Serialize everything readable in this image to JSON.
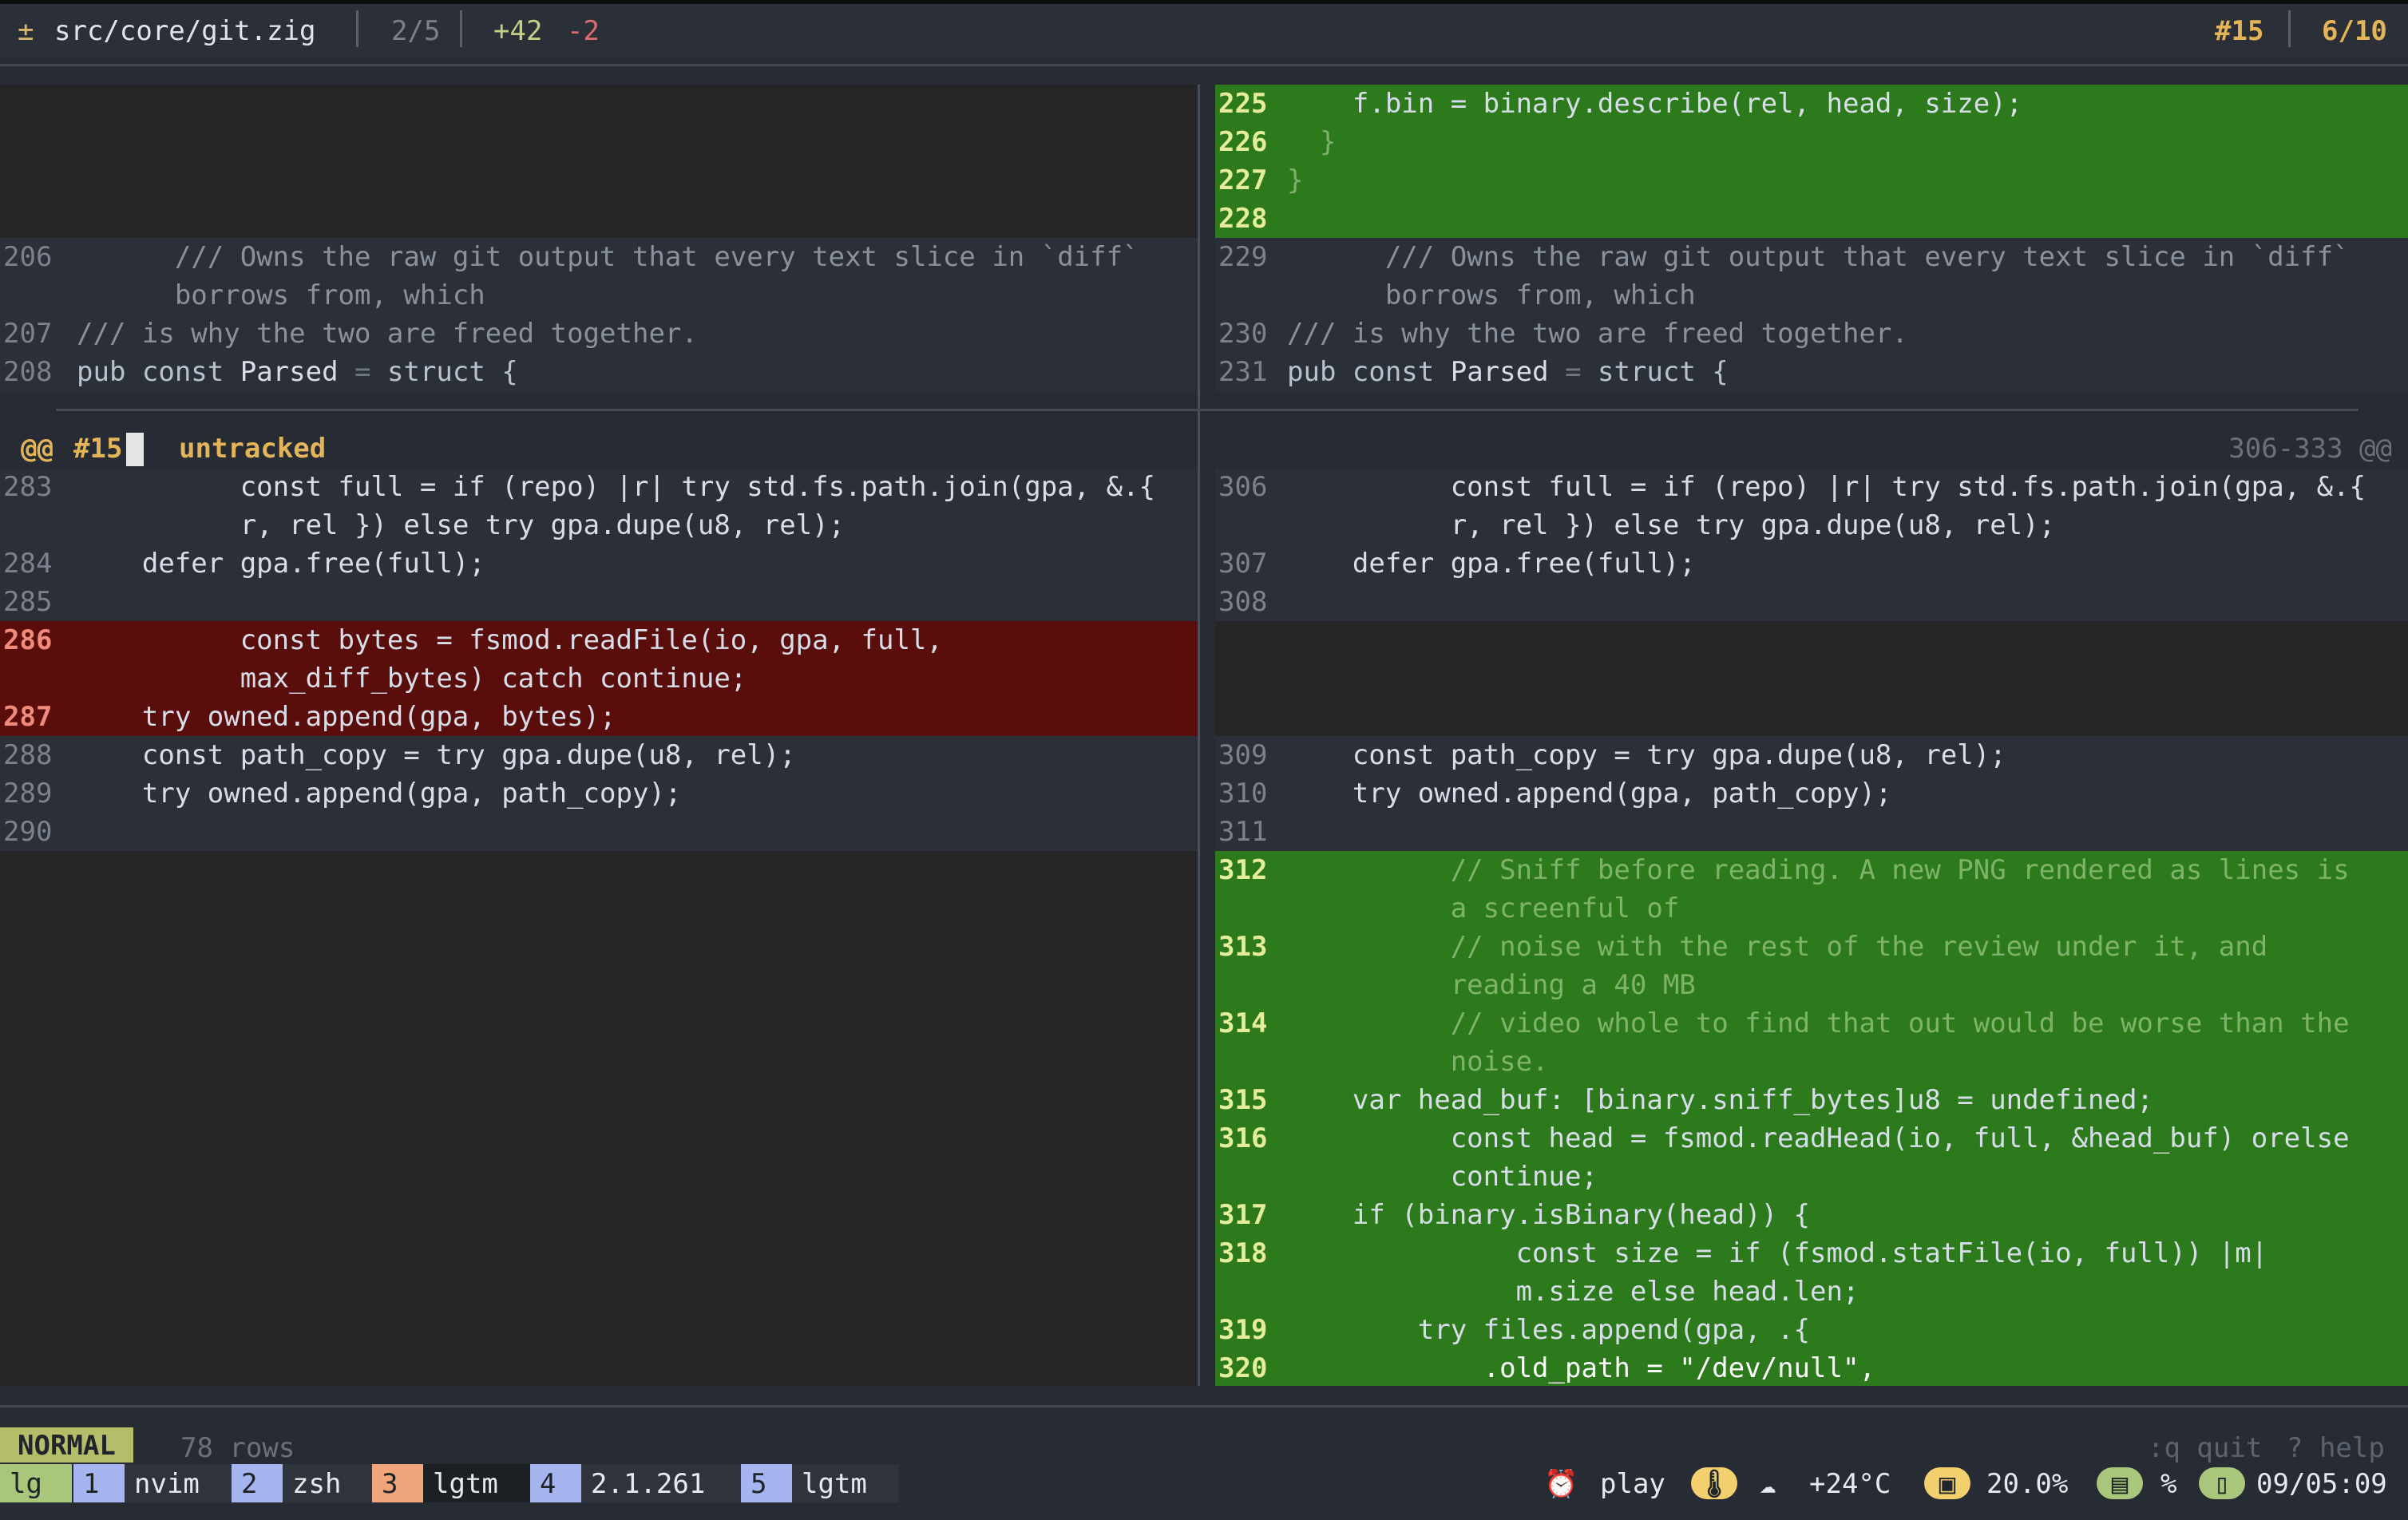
{
  "topbar": {
    "file_icon": "±",
    "file_path": "src/core/git.zig",
    "file_position": "2/5",
    "added": "+42",
    "removed": "-2",
    "hunk": "#15",
    "hunk_count": "6/10"
  },
  "left": {
    "l206a": "/// Owns the raw git output that every text slice in `diff`",
    "l206b": "borrows from, which",
    "l207": "/// is why the two are freed together.",
    "l208_kw": "pub const",
    "l208_id": "Parsed",
    "l208_eq": "=",
    "l208_rest": "struct {",
    "l283a": "    const full = if (repo) |r| try std.fs.path.join(gpa, &.{",
    "l283b": "    r, rel }) else try gpa.dupe(u8, rel);",
    "l284": "    defer gpa.free(full);",
    "l286a": "    const bytes = fsmod.readFile(io, gpa, full,",
    "l286b": "    max_diff_bytes) catch continue;",
    "l287": "    try owned.append(gpa, bytes);",
    "l288": "    const path_copy = try gpa.dupe(u8, rel);",
    "l289": "    try owned.append(gpa, path_copy);"
  },
  "right": {
    "l225": "    f.bin = binary.describe(rel, head, size);",
    "l226": "  }",
    "l227": "}",
    "l229a": "/// Owns the raw git output that every text slice in `diff`",
    "l229b": "borrows from, which",
    "l230": "/// is why the two are freed together.",
    "l231_kw": "pub const",
    "l231_id": "Parsed",
    "l231_eq": "=",
    "l231_rest": "struct {",
    "l306a": "    const full = if (repo) |r| try std.fs.path.join(gpa, &.{",
    "l306b": "    r, rel }) else try gpa.dupe(u8, rel);",
    "l307": "    defer gpa.free(full);",
    "l309": "    const path_copy = try gpa.dupe(u8, rel);",
    "l310": "    try owned.append(gpa, path_copy);",
    "l312a": "    // Sniff before reading. A new PNG rendered as lines is",
    "l312b": "    a screenful of",
    "l313a": "    // noise with the rest of the review under it, and",
    "l313b": "    reading a 40 MB",
    "l314a": "    // video whole to find that out would be worse than the",
    "l314b": "    noise.",
    "l315": "    var head_buf: [binary.sniff_bytes]u8 = undefined;",
    "l316a": "    const head = fsmod.readHead(io, full, &head_buf) orelse",
    "l316b": "    continue;",
    "l317": "    if (binary.isBinary(head)) {",
    "l318a": "        const size = if (fsmod.statFile(io, full)) |m|",
    "l318b": "        m.size else head.len;",
    "l319": "        try files.append(gpa, .{",
    "l320": "            .old_path = \"/dev/null\","
  },
  "hunk_header": {
    "marker": "@@",
    "id": "#15",
    "status": "untracked",
    "range": "306-333 @@"
  },
  "line_numbers": {
    "l206": "206",
    "l207": "207",
    "l208": "208",
    "l283": "283",
    "l284": "284",
    "l285": "285",
    "l286": "286",
    "l287": "287",
    "l288": "288",
    "l289": "289",
    "l290": "290",
    "r225": "225",
    "r226": "226",
    "r227": "227",
    "r228": "228",
    "r229": "229",
    "r230": "230",
    "r231": "231",
    "r306": "306",
    "r307": "307",
    "r308": "308",
    "r309": "309",
    "r310": "310",
    "r311": "311",
    "r312": "312",
    "r313": "313",
    "r314": "314",
    "r315": "315",
    "r316": "316",
    "r317": "317",
    "r318": "318",
    "r319": "319",
    "r320": "320"
  },
  "status": {
    "mode": "NORMAL",
    "rows": "78 rows",
    "quit": ":q quit",
    "help": "? help"
  },
  "tmux": {
    "session": "lg",
    "windows": [
      {
        "index": "1",
        "name": "nvim"
      },
      {
        "index": "2",
        "name": "zsh"
      },
      {
        "index": "3",
        "name": "lgtm"
      },
      {
        "index": "4",
        "name": "2.1.261"
      },
      {
        "index": "5",
        "name": "lgtm"
      }
    ],
    "alarm_icon": "⏰",
    "music": "play",
    "temp_icon": "🌡",
    "weather_icon": "☁",
    "weather": "+24°C",
    "cpu_icon": "▣",
    "cpu": "20.0%",
    "disk_icon": "▤",
    "disk": "%",
    "battery_icon": "▯",
    "clock": "09/05:09"
  },
  "colors": {
    "added_bg": "#2c7a1c",
    "removed_bg": "#5a0e0c",
    "accent": "#e3b558",
    "mode_bg": "#b5bd68"
  }
}
